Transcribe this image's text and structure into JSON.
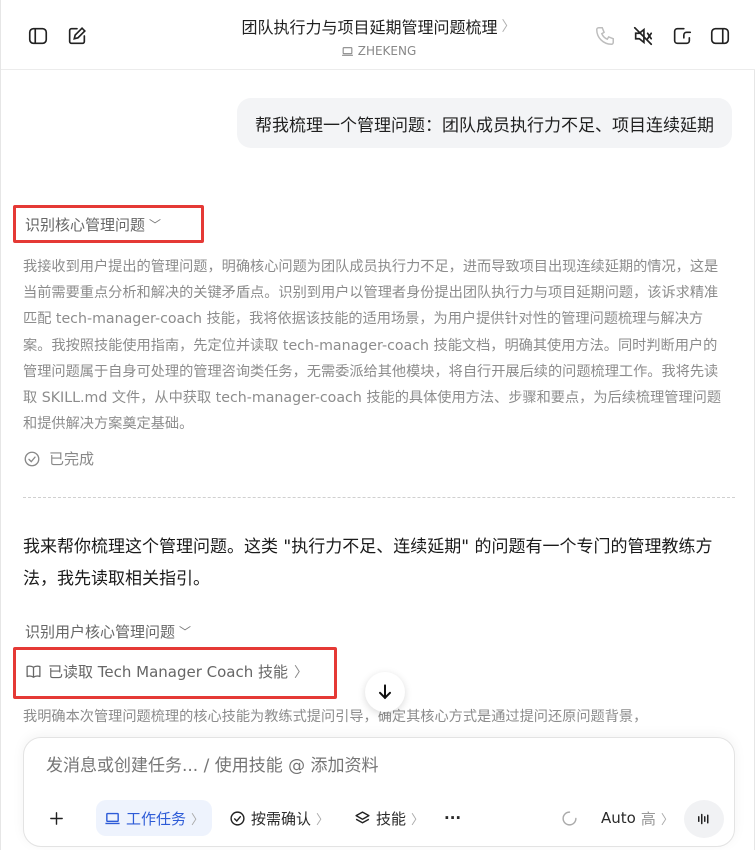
{
  "header": {
    "title": "团队执行力与项目延期管理问题梳理",
    "title_chevron": "〉",
    "workspace": "ZHEKENG"
  },
  "user_message": "帮我梳理一个管理问题：团队成员执行力不足、项目连续延期",
  "thinking": {
    "toggle_label": "识别核心管理问题",
    "chevron": "﹀",
    "text": "我接收到用户提出的管理问题，明确核心问题为团队成员执行力不足，进而导致项目出现连续延期的情况，这是当前需要重点分析和解决的关键矛盾点。识别到用户以管理者身份提出团队执行力与项目延期问题，该诉求精准匹配 tech-manager-coach 技能，我将依据该技能的适用场景，为用户提供针对性的管理问题梳理与解决方案。我按照技能使用指南，先定位并读取 tech-manager-coach 技能文档，明确其使用方法。同时判断用户的管理问题属于自身可处理的管理咨询类任务，无需委派给其他模块，将自行开展后续的问题梳理工作。我将先读取 SKILL.md 文件，从中获取 tech-manager-coach 技能的具体使用方法、步骤和要点，为后续梳理管理问题和提供解决方案奠定基础。",
    "done_label": "已完成"
  },
  "reply": {
    "text": "我来帮你梳理这个管理问题。这类 \"执行力不足、连续延期\" 的问题有一个专门的管理教练方法，我先读取相关指引。"
  },
  "second_thinking": {
    "toggle_label": "识别用户核心管理问题",
    "chevron": "﹀"
  },
  "read_skill": {
    "label": "已读取 Tech Manager Coach 技能",
    "chevron": "〉"
  },
  "faded_text": "我明确本次管理问题梳理的核心技能为教练式提问引导，确定其核心方式是通过提问还原问题背景，",
  "composer": {
    "placeholder": "发消息或创建任务... / 使用技能 @ 添加资料",
    "task_label": "工作任务",
    "confirm_label": "按需确认",
    "skills_label": "技能",
    "more_label": "···",
    "model_label": "Auto",
    "model_level": "高",
    "chevron": "〉"
  }
}
